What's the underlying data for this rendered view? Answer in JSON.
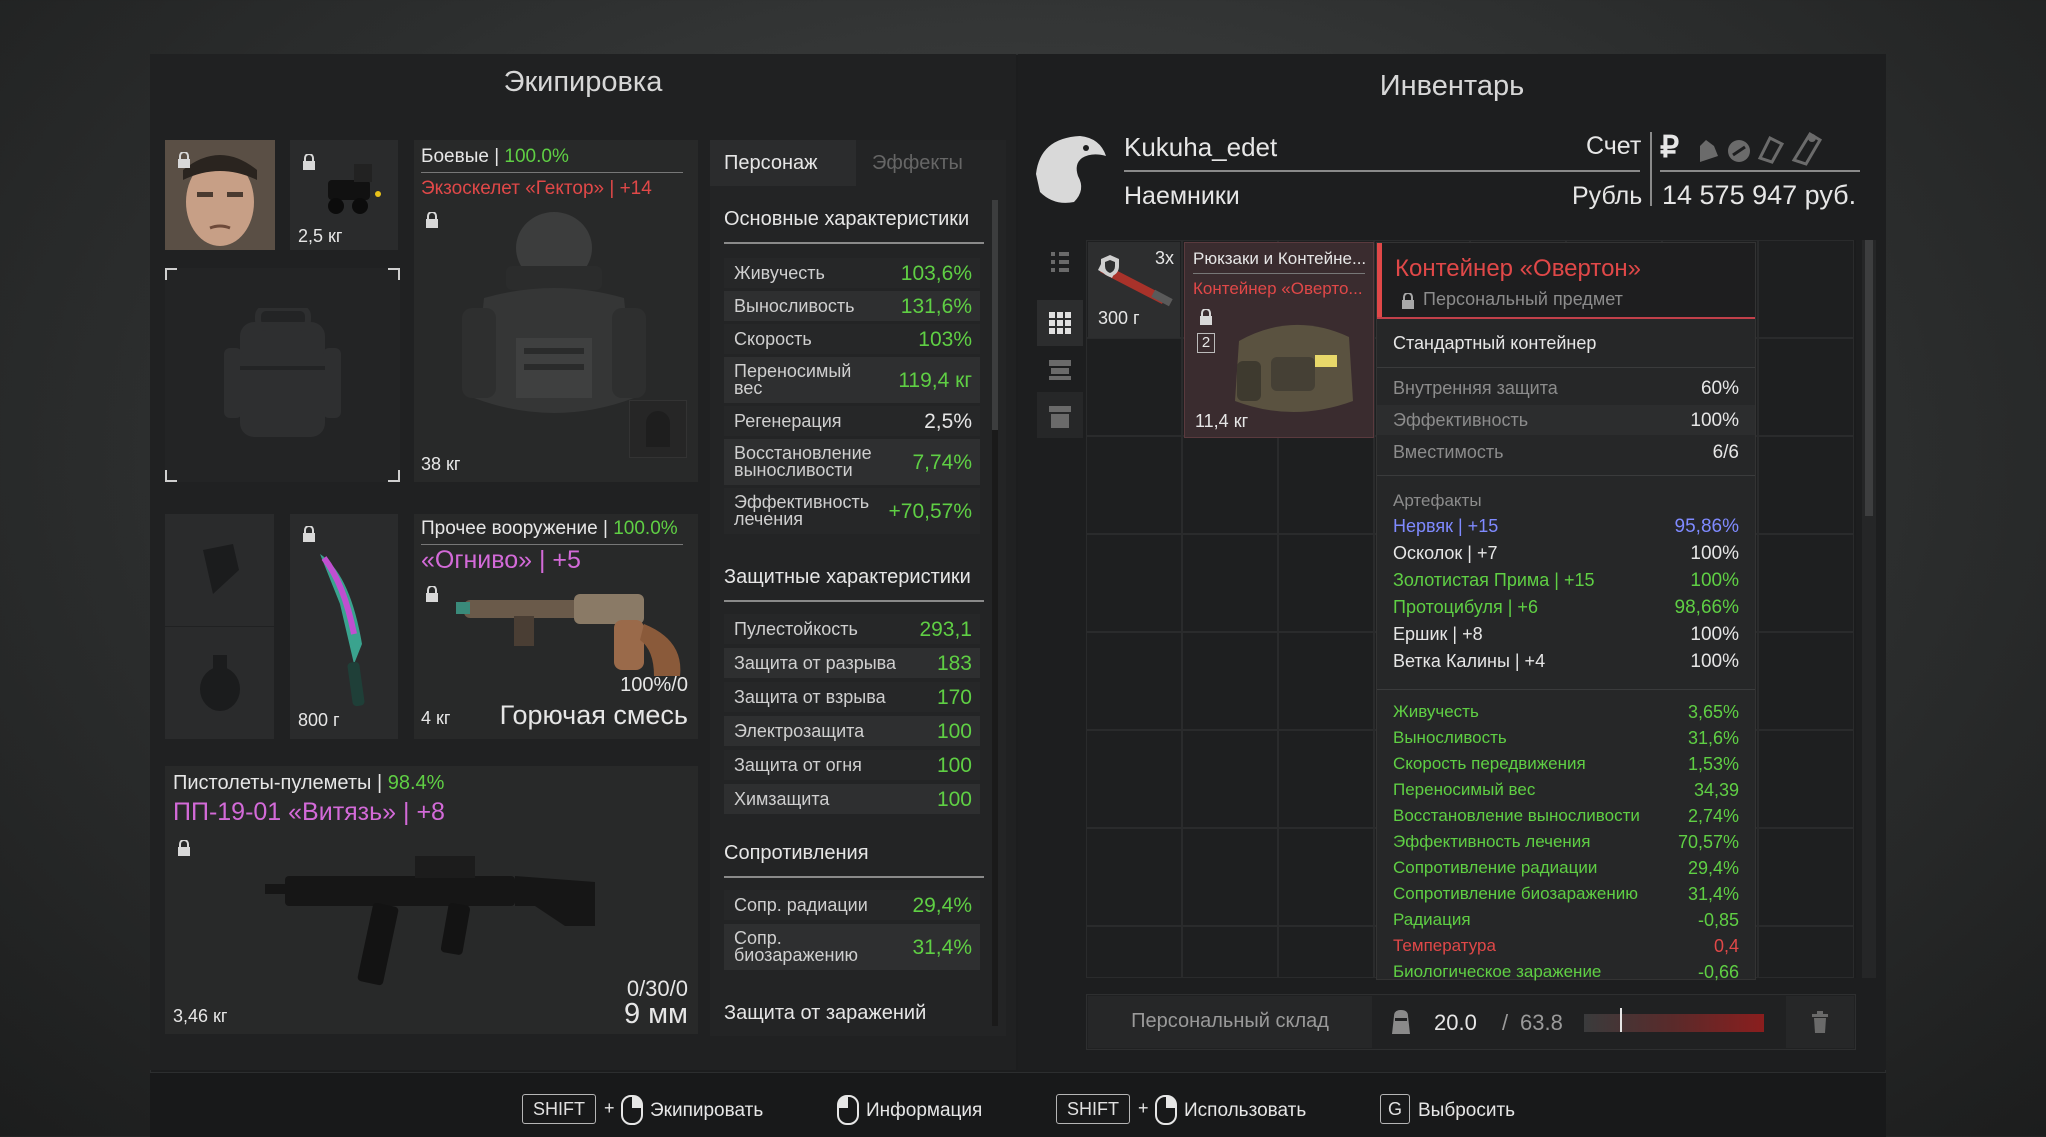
{
  "equipment": {
    "title": "Экипировка",
    "head_weight": "2,5 кг",
    "armor": {
      "category": "Боевые",
      "condition": "100.0%",
      "name": "Экзоскелет «Гектор» | +14",
      "weight": "38 кг"
    },
    "melee_weight": "800 г",
    "secondary": {
      "category": "Прочее вооружение",
      "condition": "100.0%",
      "name": "«Огниво» | +5",
      "ammo": "100%/0",
      "weight": "4 кг",
      "ammo_type": "Горючая смесь"
    },
    "primary": {
      "category": "Пистолеты-пулеметы",
      "condition": "98.4%",
      "name": "ПП-19-01 «Витязь» | +8",
      "ammo": "0/30/0",
      "weight": "3,46 кг",
      "ammo_type": "9 мм"
    }
  },
  "stats": {
    "tabs": [
      "Персонаж",
      "Эффекты"
    ],
    "basic_title": "Основные характеристики",
    "basic": [
      {
        "label": "Живучесть",
        "value": "103,6%"
      },
      {
        "label": "Выносливость",
        "value": "131,6%"
      },
      {
        "label": "Скорость",
        "value": "103%"
      },
      {
        "label": "Переносимый вес",
        "value": "119,4 кг"
      },
      {
        "label": "Регенерация",
        "value": "2,5%"
      },
      {
        "label": "Восстановление выносливости",
        "value": "7,74%"
      },
      {
        "label": "Эффективность лечения",
        "value": "+70,57%"
      }
    ],
    "protect_title": "Защитные характеристики",
    "protect": [
      {
        "label": "Пулестойкость",
        "value": "293,1"
      },
      {
        "label": "Защита от разрыва",
        "value": "183"
      },
      {
        "label": "Защита от взрыва",
        "value": "170"
      },
      {
        "label": "Электрозащита",
        "value": "100"
      },
      {
        "label": "Защита от огня",
        "value": "100"
      },
      {
        "label": "Химзащита",
        "value": "100"
      }
    ],
    "resist_title": "Сопротивления",
    "resist": [
      {
        "label": "Сопр. радиации",
        "value": "29,4%"
      },
      {
        "label": "Сопр. биозаражению",
        "value": "31,4%"
      }
    ],
    "infection_title": "Защита от заражений"
  },
  "inventory": {
    "title": "Инвентарь",
    "player_name": "Kukuha_edet",
    "faction": "Наемники",
    "account_label": "Счет",
    "currency_label": "Рубль",
    "balance": "14 575 947 руб.",
    "items": [
      {
        "count": "3x",
        "weight": "300 г"
      },
      {
        "category": "Рюкзаки и Контейне...",
        "name": "Контейнер «Оверто...",
        "slots": "2",
        "weight": "11,4 кг"
      }
    ],
    "storage_label": "Персональный склад",
    "weight_current": "20.0",
    "weight_sep": "/",
    "weight_max": "63.8",
    "weight_fill": 0.66
  },
  "tooltip": {
    "title": "Контейнер «Овертон»",
    "subtitle": "Персональный предмет",
    "type": "Стандартный контейнер",
    "props": [
      {
        "label": "Внутренняя защита",
        "value": "60%"
      },
      {
        "label": "Эффективность",
        "value": "100%"
      },
      {
        "label": "Вместимость",
        "value": "6/6"
      }
    ],
    "artifacts_title": "Артефакты",
    "artifacts": [
      {
        "label": "Нервяк | +15",
        "value": "95,86%",
        "color": "#7f8aff"
      },
      {
        "label": "Осколок | +7",
        "value": "100%",
        "color": "#e6e6e6"
      },
      {
        "label": "Золотистая Прима | +15",
        "value": "100%",
        "color": "#5fcf44"
      },
      {
        "label": "Протоцибуля | +6",
        "value": "98,66%",
        "color": "#5fcf44"
      },
      {
        "label": "Ершик | +8",
        "value": "100%",
        "color": "#e6e6e6"
      },
      {
        "label": "Ветка Калины | +4",
        "value": "100%",
        "color": "#e6e6e6"
      }
    ],
    "effects": [
      {
        "label": "Живучесть",
        "value": "3,65%",
        "color": "#5fcf44"
      },
      {
        "label": "Выносливость",
        "value": "31,6%",
        "color": "#5fcf44"
      },
      {
        "label": "Скорость передвижения",
        "value": "1,53%",
        "color": "#5fcf44"
      },
      {
        "label": "Переносимый вес",
        "value": "34,39",
        "color": "#5fcf44"
      },
      {
        "label": "Восстановление выносливости",
        "value": "2,74%",
        "color": "#5fcf44"
      },
      {
        "label": "Эффективность лечения",
        "value": "70,57%",
        "color": "#5fcf44"
      },
      {
        "label": "Сопротивление радиации",
        "value": "29,4%",
        "color": "#5fcf44"
      },
      {
        "label": "Сопротивление биозаражению",
        "value": "31,4%",
        "color": "#5fcf44"
      },
      {
        "label": "Радиация",
        "value": "-0,85",
        "color": "#5fcf44"
      },
      {
        "label": "Температура",
        "value": "0,4",
        "color": "#e04848"
      },
      {
        "label": "Биологическое заражение",
        "value": "-0,66",
        "color": "#5fcf44"
      }
    ]
  },
  "hints": [
    {
      "key": "SHIFT",
      "plus": "+",
      "label": "Экипировать"
    },
    {
      "label": "Информация"
    },
    {
      "key": "SHIFT",
      "plus": "+",
      "label": "Использовать"
    },
    {
      "key": "G",
      "label": "Выбросить"
    }
  ]
}
